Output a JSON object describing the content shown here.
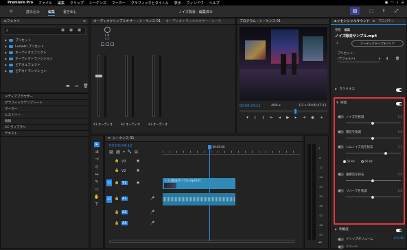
{
  "menubar": {
    "apple": "",
    "app": "Premiere Pro",
    "items": [
      "ファイル",
      "編集",
      "クリップ",
      "シーケンス",
      "マーカー",
      "グラフィックとタイトル",
      "表示",
      "ウィンドウ",
      "ヘルプ"
    ]
  },
  "titlebar": {
    "tabs": [
      "読み込み",
      "編集",
      "書き出し"
    ],
    "title": "ノイズ除去 - 編集済み"
  },
  "effects": {
    "title": "エフェクト",
    "items": [
      "プリセット",
      "Lumetri プリセット",
      "オーディオエフェクト",
      "オーディオトランジション",
      "ビデオエフェクト",
      "ビデオトランジション"
    ]
  },
  "lower_left": {
    "items": [
      "メディアブラウザー",
      "グラフィックテンプレート",
      "マーカー",
      "ヒストリー",
      "情報",
      "CC ライブラリ",
      "テキスト"
    ]
  },
  "mixer": {
    "tab1": "オーディオクリップミキサー : シーケンス 01",
    "tab2": "オーディオトラックミキサー : シーケ",
    "channels": [
      "A1",
      "A2",
      "A3"
    ],
    "ch_label": "オーディオ",
    "knob_label": "L  R",
    "value": "0.0"
  },
  "program": {
    "title": "プログラム : シーケンス 01",
    "timecode": "00:00:04:12",
    "zoom": "49%",
    "quality": "1/2",
    "duration": "00:00:07:13"
  },
  "timeline": {
    "title": "シーケンス 01",
    "timecode": "00:00:04:12",
    "ruler_mid": "00:00:05:00",
    "video_tracks": [
      "V3",
      "V2",
      "V1"
    ],
    "audio_tracks": [
      "A1",
      "A2",
      "A3"
    ],
    "clip_label": "ノイズ除去サンプル.mp4 [V]"
  },
  "meters": {
    "scale": [
      "0",
      "-6",
      "-12",
      "-18",
      "-24",
      "-30",
      "-36",
      "-42",
      "-48",
      "-54"
    ],
    "unit": "dB"
  },
  "essential": {
    "tab": "エッセンシャルサウンド",
    "tab2": "プロパティ",
    "subtabs": [
      "参照",
      "編集"
    ],
    "filename": "ノイズ除去サンプル.mp4",
    "clear_button": "オーディオタイプをクリア",
    "preset_label": "プリセット：",
    "preset_value": "(デフォルト)",
    "loudness": "ラウドネス",
    "repair": "修復",
    "rows": [
      {
        "label": "ノイズを軽減",
        "val": "5.0"
      },
      {
        "label": "雑音を削減",
        "val": "5.0"
      },
      {
        "label": "ハムノイズ音を除去",
        "val": "7.1"
      },
      {
        "label": "歯擦音を除去",
        "val": "5.0"
      },
      {
        "label": "リバーブを低減",
        "val": "5.0"
      }
    ],
    "hz50": "50 Hz",
    "hz60": "60 Hz",
    "clarity": "明瞭度",
    "clip_volume": "クリップボリューム",
    "clip_volume_val": "0.0 dB",
    "mute": "ミュート"
  },
  "colors": {
    "accent": "#2d8ceb",
    "highlight": "#e8363b",
    "clip": "#2f8ab8",
    "audio": "#2a7aa0"
  }
}
